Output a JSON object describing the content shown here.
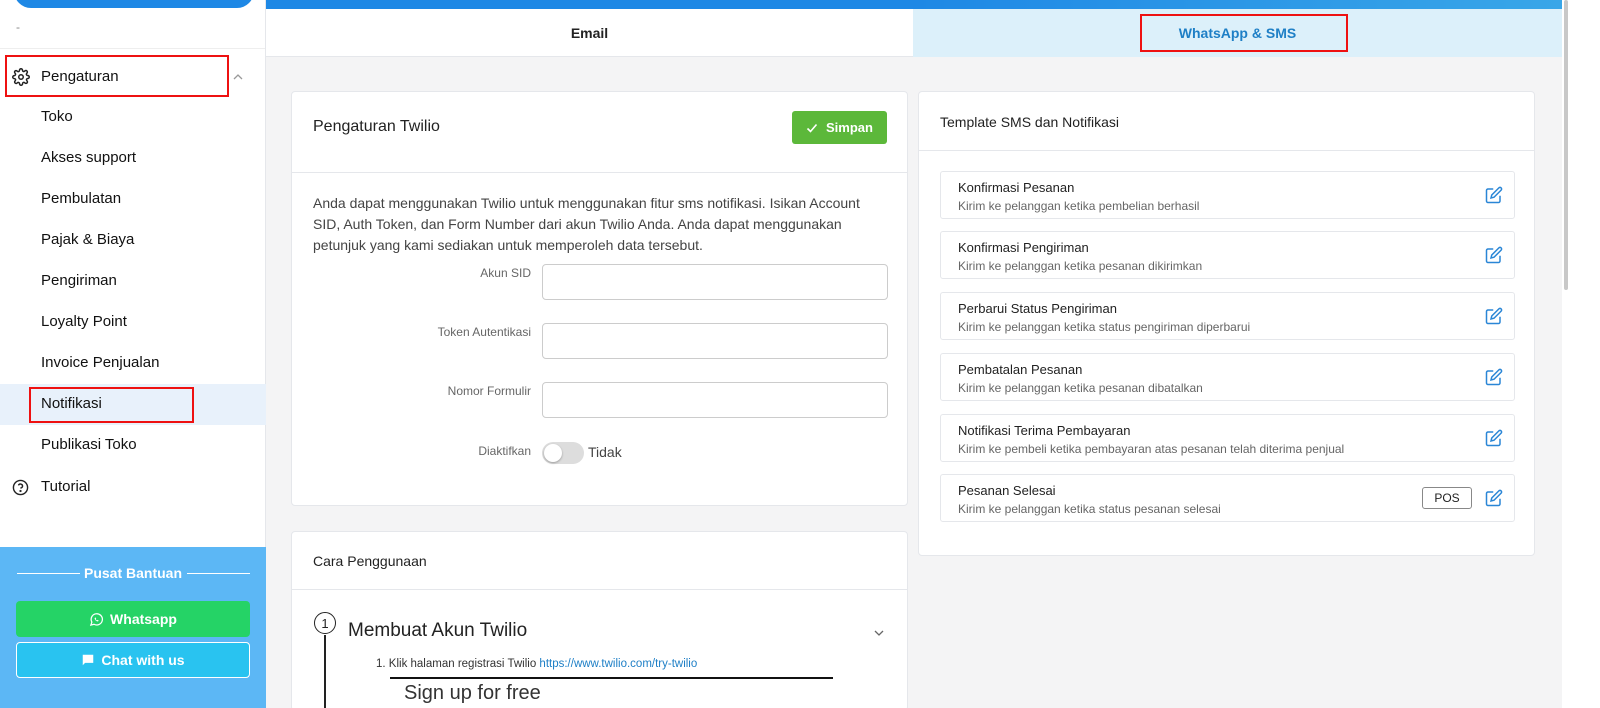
{
  "sidebar": {
    "dash": "-",
    "group_label": "Pengaturan",
    "items": [
      {
        "label": "Toko"
      },
      {
        "label": "Akses support"
      },
      {
        "label": "Pembulatan"
      },
      {
        "label": "Pajak & Biaya"
      },
      {
        "label": "Pengiriman"
      },
      {
        "label": "Loyalty Point"
      },
      {
        "label": "Invoice Penjualan"
      },
      {
        "label": "Notifikasi"
      },
      {
        "label": "Publikasi Toko"
      }
    ],
    "active_item": "Notifikasi",
    "tutorial_label": "Tutorial"
  },
  "help": {
    "title": "Pusat Bantuan",
    "whatsapp_label": "Whatsapp",
    "chat_label": "Chat with us"
  },
  "tabs": {
    "email": "Email",
    "whatsapp_sms": "WhatsApp & SMS",
    "active": "WhatsApp & SMS"
  },
  "twilio": {
    "title": "Pengaturan Twilio",
    "save_label": "Simpan",
    "description": "Anda dapat menggunakan Twilio untuk menggunakan fitur sms notifikasi. Isikan Account SID, Auth Token, dan Form Number dari akun Twilio Anda. Anda dapat menggunakan petunjuk yang kami sediakan untuk memperoleh data tersebut.",
    "fields": {
      "akun_sid_label": "Akun SID",
      "akun_sid_value": "",
      "token_label": "Token Autentikasi",
      "token_value": "",
      "nomor_label": "Nomor Formulir",
      "nomor_value": "",
      "enabled_label": "Diaktifkan",
      "enabled_text": "Tidak"
    }
  },
  "cara": {
    "title": "Cara Penggunaan",
    "step_number": "1",
    "step_title": "Membuat Akun Twilio",
    "step_item_text": "1. Klik halaman registrasi Twilio ",
    "step_item_link": "https://www.twilio.com/try-twilio",
    "step_cut_text": "Sign up for free"
  },
  "templates": {
    "title": "Template SMS dan Notifikasi",
    "items": [
      {
        "name": "Konfirmasi Pesanan",
        "desc": "Kirim ke pelanggan ketika pembelian berhasil"
      },
      {
        "name": "Konfirmasi Pengiriman",
        "desc": "Kirim ke pelanggan ketika pesanan dikirimkan"
      },
      {
        "name": "Perbarui Status Pengiriman",
        "desc": "Kirim ke pelanggan ketika status pengiriman diperbarui"
      },
      {
        "name": "Pembatalan Pesanan",
        "desc": "Kirim ke pelanggan ketika pesanan dibatalkan"
      },
      {
        "name": "Notifikasi Terima Pembayaran",
        "desc": "Kirim ke pembeli ketika pembayaran atas pesanan telah diterima penjual"
      },
      {
        "name": "Pesanan Selesai",
        "desc": "Kirim ke pelanggan ketika status pesanan selesai",
        "badge": "POS"
      }
    ]
  },
  "colors": {
    "accent": "#1e88e5",
    "save_green": "#5cb83a",
    "highlight_red": "#ee1111",
    "help_bg": "#5cb7f5",
    "whatsapp_green": "#25d366"
  }
}
